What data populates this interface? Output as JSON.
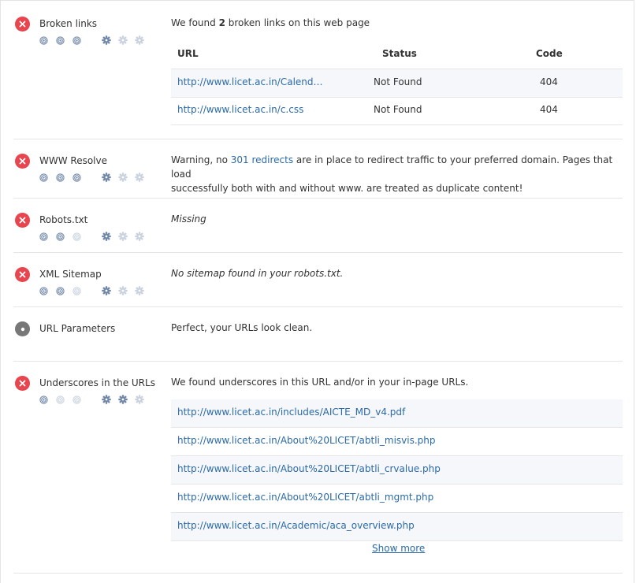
{
  "checks": [
    {
      "id": "broken-links",
      "title": "Broken links",
      "status": "error",
      "summary_prefix": "We found ",
      "summary_count": "2",
      "summary_suffix": " broken links on this web page",
      "table": {
        "headers": [
          "URL",
          "Status",
          "Code"
        ],
        "rows": [
          {
            "url": "http://www.licet.ac.in/Calend…",
            "status": "Not Found",
            "code": "404"
          },
          {
            "url": "http://www.licet.ac.in/c.css",
            "status": "Not Found",
            "code": "404"
          }
        ]
      }
    },
    {
      "id": "www-resolve",
      "title": "WWW Resolve",
      "status": "error",
      "text_before": "Warning, no ",
      "link_text": "301 redirects",
      "text_after_line1": " are in place to redirect traffic to your preferred domain. Pages that load",
      "text_line2": "successfully both with and without www. are treated as duplicate content!"
    },
    {
      "id": "robots-txt",
      "title": "Robots.txt",
      "status": "error",
      "message": "Missing"
    },
    {
      "id": "xml-sitemap",
      "title": "XML Sitemap",
      "status": "error",
      "message": "No sitemap found in your robots.txt."
    },
    {
      "id": "url-parameters",
      "title": "URL Parameters",
      "status": "ok",
      "message": "Perfect, your URLs look clean."
    },
    {
      "id": "underscores",
      "title": "Underscores in the URLs",
      "status": "error",
      "message": "We found underscores in this URL and/or in your in-page URLs.",
      "urls": [
        "http://www.licet.ac.in/includes/AICTE_MD_v4.pdf",
        "http://www.licet.ac.in/About%20LICET/abtli_misvis.php",
        "http://www.licet.ac.in/About%20LICET/abtli_crvalue.php",
        "http://www.licet.ac.in/About%20LICET/abtli_mgmt.php",
        "http://www.licet.ac.in/Academic/aca_overview.php"
      ],
      "show_more": "Show more"
    }
  ],
  "colors": {
    "error": "#e8454f",
    "ok": "#777777",
    "link": "#2b6aa8",
    "meter_active": "#6f86a6",
    "meter_inactive": "#c9d2de"
  },
  "meter_levels": {
    "broken-links": {
      "importance": 3,
      "difficulty": 1
    },
    "www-resolve": {
      "importance": 3,
      "difficulty": 1
    },
    "robots-txt": {
      "importance": 2,
      "difficulty": 1
    },
    "xml-sitemap": {
      "importance": 2,
      "difficulty": 1
    },
    "url-parameters": {
      "importance": 0,
      "difficulty": 0
    },
    "underscores": {
      "importance": 1,
      "difficulty": 2
    }
  }
}
